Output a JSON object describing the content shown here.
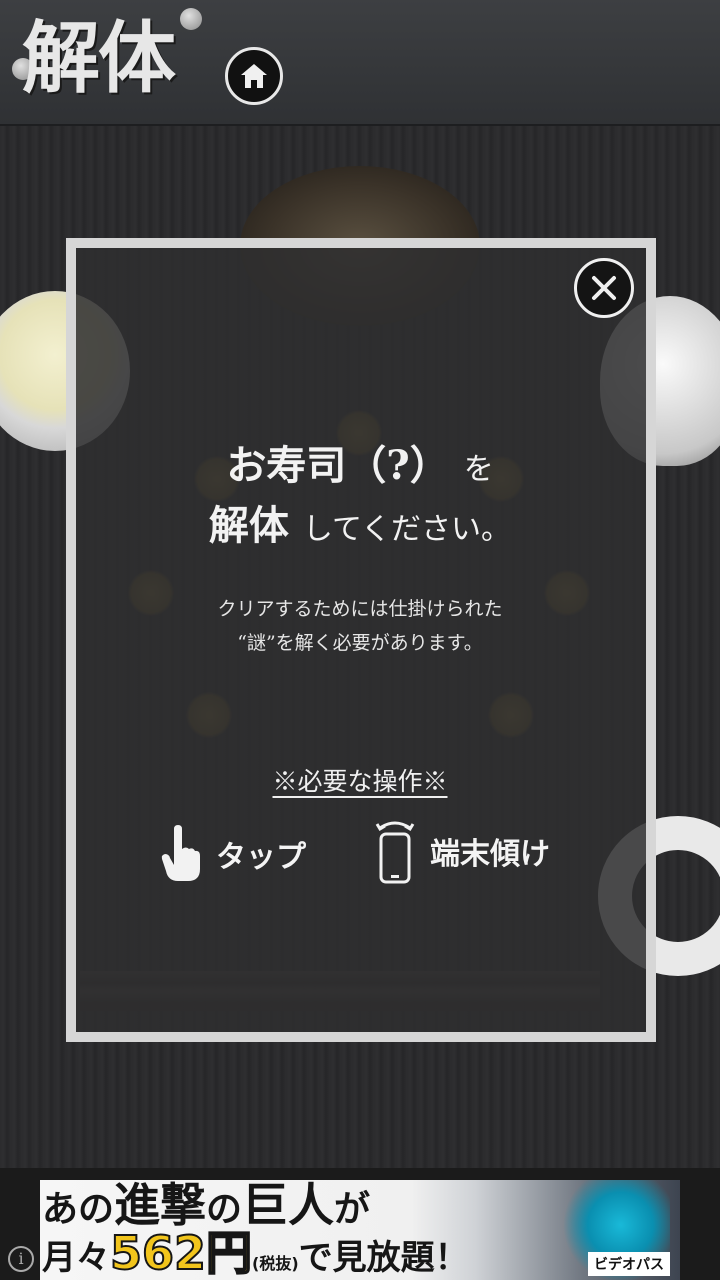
{
  "header": {
    "logo_text": "解体",
    "home_icon": "home-icon"
  },
  "modal": {
    "close_icon": "close-icon",
    "title_main": "お寿司（?）",
    "title_particle": "を",
    "title_second_bold": "解体",
    "title_second_rest": "してください。",
    "desc_line1": "クリアするためには仕掛けられた",
    "desc_line2": "“謎”を解く必要があります。",
    "ops_title": "※必要な操作※",
    "ops": [
      {
        "icon": "tap-hand-icon",
        "label": "タップ"
      },
      {
        "icon": "tilt-device-icon",
        "label": "端末傾け"
      }
    ]
  },
  "ad": {
    "info_icon": "i",
    "line1_a": "あの",
    "line1_b": "進撃",
    "line1_c": "の",
    "line1_d": "巨人",
    "line1_e": "が",
    "line2_a": "月々",
    "line2_price": "562円",
    "line2_tax": "(税抜)",
    "line2_b": "で見放題！",
    "brand": "ビデオパス"
  }
}
